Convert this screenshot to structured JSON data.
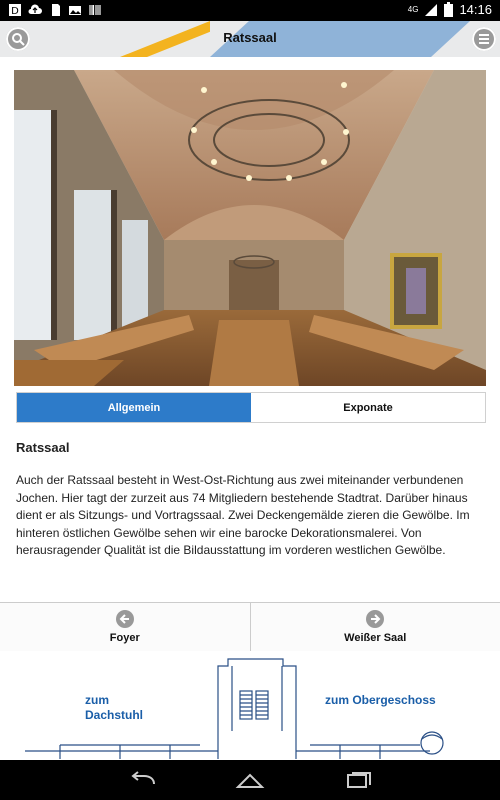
{
  "status_bar": {
    "time": "14:16",
    "network": "4G",
    "icons": [
      "notification-icon",
      "cloud-upload-icon",
      "sd-card-icon",
      "photo-icon",
      "barcode-icon",
      "signal-icon",
      "battery-icon"
    ]
  },
  "header": {
    "title": "Ratssaal",
    "left_icon": "search-icon",
    "right_icon": "menu-icon",
    "stripe_colors": [
      "#f3b31f",
      "#8fb3d8"
    ]
  },
  "tabs": [
    {
      "label": "Allgemein",
      "active": true
    },
    {
      "label": "Exponate",
      "active": false
    }
  ],
  "content": {
    "title": "Ratssaal",
    "text": "Auch der Ratssaal besteht in West-Ost-Richtung aus zwei miteinander verbundenen Jochen. Hier tagt der zurzeit aus 74 Mitgliedern bestehende Stadtrat. Darüber hinaus dient er als Sitzungs- und Vortragssaal. Zwei Deckengemälde zieren die Gewölbe. Im hinteren östlichen Gewölbe sehen wir eine barocke Dekorationsmalerei. Von herausragender Qualität ist die Bildausstattung im vorderen westlichen Gewölbe."
  },
  "navigation": {
    "prev_label": "Foyer",
    "next_label": "Weißer Saal"
  },
  "map": {
    "left_label_line1": "zum",
    "left_label_line2": "Dachstuhl",
    "right_label": "zum Obergeschoss"
  },
  "colors": {
    "accent": "#2d7bc9",
    "map_label": "#1a5ea8"
  }
}
